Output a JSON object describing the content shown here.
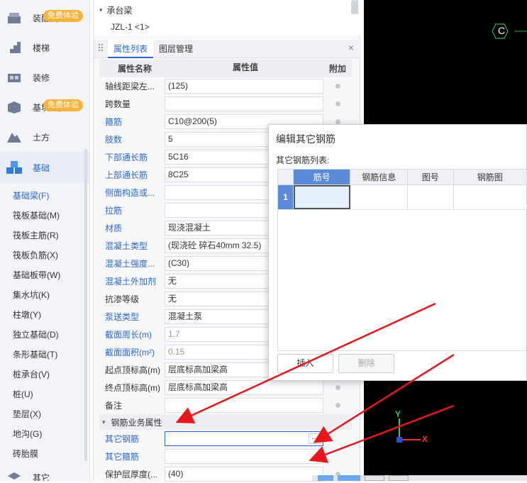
{
  "sidebar": {
    "items": [
      {
        "label": "装配式",
        "badge": "免费体验"
      },
      {
        "label": "楼梯",
        "badge": ""
      },
      {
        "label": "装修",
        "badge": ""
      },
      {
        "label": "基坑支护",
        "badge": "免费体验"
      },
      {
        "label": "土方",
        "badge": ""
      },
      {
        "label": "基础",
        "badge": ""
      }
    ],
    "sub_items": [
      "基础梁(F)",
      "筏板基础(M)",
      "筏板主筋(R)",
      "筏板负筋(X)",
      "基础板带(W)",
      "集水坑(K)",
      "柱墩(Y)",
      "独立基础(D)",
      "条形基础(T)",
      "桩承台(V)",
      "桩(U)",
      "垫层(X)",
      "地沟(G)",
      "砖胎膜"
    ],
    "bottom_item": "其它"
  },
  "tree": {
    "parent": "承台梁",
    "child": "JZL-1 <1>"
  },
  "panel": {
    "tab_properties": "属性列表",
    "tab_layers": "图层管理",
    "close": "×",
    "col_name": "属性名称",
    "col_value": "属性值",
    "col_add": "附加",
    "rows": [
      {
        "name": "轴线距梁左...",
        "value": "(125)",
        "blue": false,
        "grey": false
      },
      {
        "name": "跨数量",
        "value": "",
        "blue": false,
        "grey": false
      },
      {
        "name": "箍筋",
        "value": "C10@200(5)",
        "blue": true,
        "grey": false
      },
      {
        "name": "肢数",
        "value": "5",
        "blue": true,
        "grey": false
      },
      {
        "name": "下部通长筋",
        "value": "5C16",
        "blue": true,
        "grey": false
      },
      {
        "name": "上部通长筋",
        "value": "8C25",
        "blue": true,
        "grey": false
      },
      {
        "name": "侧面构造或...",
        "value": "",
        "blue": true,
        "grey": false
      },
      {
        "name": "拉筋",
        "value": "",
        "blue": true,
        "grey": false
      },
      {
        "name": "材质",
        "value": "现浇混凝土",
        "blue": true,
        "grey": false
      },
      {
        "name": "混凝土类型",
        "value": "(现浇砼 碎石40mm 32.5)",
        "blue": true,
        "grey": false
      },
      {
        "name": "混凝土强度...",
        "value": "(C30)",
        "blue": true,
        "grey": false
      },
      {
        "name": "混凝土外加剂",
        "value": "无",
        "blue": true,
        "grey": false
      },
      {
        "name": "抗渗等级",
        "value": "无",
        "blue": false,
        "grey": false
      },
      {
        "name": "泵送类型",
        "value": "混凝土泵",
        "blue": true,
        "grey": false
      },
      {
        "name": "截面周长(m)",
        "value": "1.7",
        "blue": true,
        "grey": true
      },
      {
        "name": "截面面积(m²)",
        "value": "0.15",
        "blue": true,
        "grey": true
      },
      {
        "name": "起点顶标高(m)",
        "value": "层底标高加梁高",
        "blue": false,
        "grey": false
      },
      {
        "name": "终点顶标高(m)",
        "value": "层底标高加梁高",
        "blue": false,
        "grey": false
      },
      {
        "name": "备注",
        "value": "",
        "blue": false,
        "grey": false
      }
    ],
    "section": "钢筋业务属性",
    "section_rows": [
      {
        "name": "其它钢筋",
        "value": ""
      },
      {
        "name": "其它箍筋",
        "value": ""
      },
      {
        "name": "保护层厚度(...",
        "value": "(40)"
      }
    ],
    "ellipsis": "···"
  },
  "dialog": {
    "title": "编辑其它钢筋",
    "list_label": "其它钢筋列表:",
    "columns": [
      "筋号",
      "钢筋信息",
      "图号",
      "钢筋图"
    ],
    "row_number": "1",
    "insert_button": "插入",
    "delete_button": "删除"
  },
  "canvas": {
    "axis_label": "C",
    "axis_y": "Y",
    "axis_x": "X"
  }
}
